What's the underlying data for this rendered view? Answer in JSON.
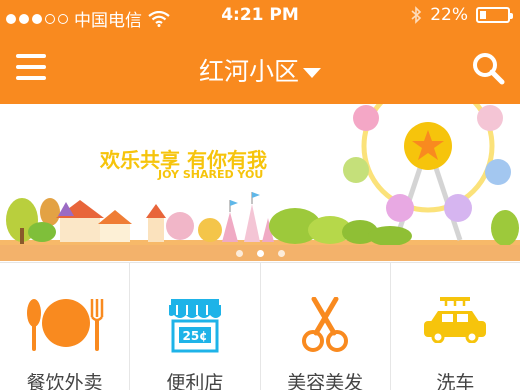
{
  "status_bar": {
    "carrier": "中国电信",
    "time": "4:21 PM",
    "battery_text": "22%",
    "battery_level": 0.22,
    "signal_bars_filled": 3,
    "signal_bars_total": 5
  },
  "nav": {
    "title": "红河小区"
  },
  "banner": {
    "headline": "欢乐共享 有你有我",
    "subline": "JOY SHARED YOU",
    "page_count": 3,
    "active_page": 2
  },
  "categories": [
    {
      "label": "餐饮外卖",
      "icon": "dining-icon"
    },
    {
      "label": "便利店",
      "icon": "store-icon"
    },
    {
      "label": "美容美发",
      "icon": "scissors-icon"
    },
    {
      "label": "洗车",
      "icon": "car-wash-icon"
    }
  ],
  "colors": {
    "brand": "#f98a1f",
    "headline_yellow": "#f6c40c",
    "icon_orange": "#f98a1f",
    "icon_yellow": "#f6c40c",
    "icon_blue": "#1eb3e8"
  }
}
